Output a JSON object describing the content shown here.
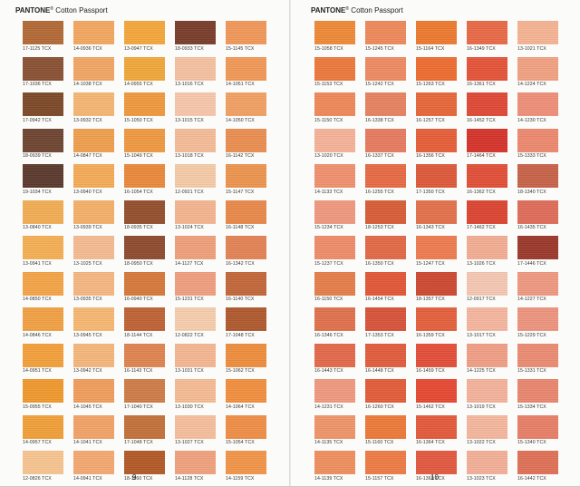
{
  "pages": [
    {
      "header_brand": "PANTONE",
      "header_reg": "®",
      "header_title": "Cotton Passport",
      "page_number": "9",
      "rows": [
        [
          {
            "code": "17-1125 TCX",
            "color": "#b46a38"
          },
          {
            "code": "14-0936 TCX",
            "color": "#f4a862"
          },
          {
            "code": "13-0947 TCX",
            "color": "#f5a83c"
          },
          {
            "code": "18-0933 TCX",
            "color": "#7a3d2c"
          },
          {
            "code": "15-1145 TCX",
            "color": "#f2995a"
          }
        ],
        [
          {
            "code": "17-1036 TCX",
            "color": "#8a5234"
          },
          {
            "code": "14-1038 TCX",
            "color": "#f3a766"
          },
          {
            "code": "14-0955 TCX",
            "color": "#f2a93d"
          },
          {
            "code": "13-1016 TCX",
            "color": "#f6c2a2"
          },
          {
            "code": "14-1051 TCX",
            "color": "#f29a58"
          }
        ],
        [
          {
            "code": "17-0942 TCX",
            "color": "#7d4a2a"
          },
          {
            "code": "13-0932 TCX",
            "color": "#f7b874"
          },
          {
            "code": "15-1050 TCX",
            "color": "#f19a3f"
          },
          {
            "code": "13-1015 TCX",
            "color": "#f8c8ad"
          },
          {
            "code": "14-1050 TCX",
            "color": "#f2a264"
          }
        ],
        [
          {
            "code": "18-0939 TCX",
            "color": "#6f4532"
          },
          {
            "code": "14-0847 TCX",
            "color": "#f0a050"
          },
          {
            "code": "15-1049 TCX",
            "color": "#f09a42"
          },
          {
            "code": "13-1018 TCX",
            "color": "#f6bd9a"
          },
          {
            "code": "16-1142 TCX",
            "color": "#ec8f52"
          }
        ],
        [
          {
            "code": "19-1034 TCX",
            "color": "#5c3a2e"
          },
          {
            "code": "13-0940 TCX",
            "color": "#f6ac58"
          },
          {
            "code": "16-1054 TCX",
            "color": "#eb8a3c"
          },
          {
            "code": "12-0921 TCX",
            "color": "#f7cca9"
          },
          {
            "code": "15-1147 TCX",
            "color": "#ee9550"
          }
        ],
        [
          {
            "code": "13-0840 TCX",
            "color": "#f3ae55"
          },
          {
            "code": "13-0939 TCX",
            "color": "#f6b26a"
          },
          {
            "code": "18-0935 TCX",
            "color": "#95502e"
          },
          {
            "code": "13-1024 TCX",
            "color": "#f5b790"
          },
          {
            "code": "16-1148 TCX",
            "color": "#ea8a4c"
          }
        ],
        [
          {
            "code": "13-0941 TCX",
            "color": "#f6b056"
          },
          {
            "code": "13-1025 TCX",
            "color": "#f6bc92"
          },
          {
            "code": "18-0950 TCX",
            "color": "#8e4c30"
          },
          {
            "code": "14-1127 TCX",
            "color": "#f0a07c"
          },
          {
            "code": "16-1342 TCX",
            "color": "#e58456"
          }
        ],
        [
          {
            "code": "14-0850 TCX",
            "color": "#f5a548"
          },
          {
            "code": "13-0935 TCX",
            "color": "#f7b882"
          },
          {
            "code": "16-0940 TCX",
            "color": "#d77a3c"
          },
          {
            "code": "15-1231 TCX",
            "color": "#f1a080"
          },
          {
            "code": "16-1140 TCX",
            "color": "#c4683c"
          }
        ],
        [
          {
            "code": "14-0846 TCX",
            "color": "#f2a245"
          },
          {
            "code": "13-0945 TCX",
            "color": "#f8b973"
          },
          {
            "code": "18-1144 TCX",
            "color": "#c06436"
          },
          {
            "code": "12-0822 TCX",
            "color": "#f7cfae"
          },
          {
            "code": "17-1048 TCX",
            "color": "#b15a30"
          }
        ],
        [
          {
            "code": "14-0951 TCX",
            "color": "#f4a13c"
          },
          {
            "code": "13-0942 TCX",
            "color": "#f7b87c"
          },
          {
            "code": "16-1143 TCX",
            "color": "#e08552"
          },
          {
            "code": "13-1031 TCX",
            "color": "#f6b894"
          },
          {
            "code": "15-1062 TCX",
            "color": "#ef8e3e"
          }
        ],
        [
          {
            "code": "15-0955 TCX",
            "color": "#f19a2f"
          },
          {
            "code": "14-1045 TCX",
            "color": "#f29e5e"
          },
          {
            "code": "17-1040 TCX",
            "color": "#d07d48"
          },
          {
            "code": "13-1030 TCX",
            "color": "#f7bd95"
          },
          {
            "code": "14-1064 TCX",
            "color": "#f39040"
          }
        ],
        [
          {
            "code": "14-0957 TCX",
            "color": "#f2a03a"
          },
          {
            "code": "14-1041 TCX",
            "color": "#f2a468"
          },
          {
            "code": "17-1048 TCX",
            "color": "#c4723c"
          },
          {
            "code": "13-1027 TCX",
            "color": "#f7c09d"
          },
          {
            "code": "15-1054 TCX",
            "color": "#f08f48"
          }
        ],
        [
          {
            "code": "12-0826 TCX",
            "color": "#f8c690"
          },
          {
            "code": "14-0941 TCX",
            "color": "#f5aa72"
          },
          {
            "code": "18-1160 TCX",
            "color": "#b45a28"
          },
          {
            "code": "14-1128 TCX",
            "color": "#f1a27e"
          },
          {
            "code": "14-1159 TCX",
            "color": "#f3964a"
          }
        ]
      ]
    },
    {
      "header_brand": "PANTONE",
      "header_reg": "®",
      "header_title": "Cotton Passport",
      "page_number": "10",
      "rows": [
        [
          {
            "code": "15-1058 TCX",
            "color": "#ef8a38"
          },
          {
            "code": "15-1245 TCX",
            "color": "#ef8a5c"
          },
          {
            "code": "15-1164 TCX",
            "color": "#ee7a30"
          },
          {
            "code": "16-1349 TCX",
            "color": "#ea6a48"
          },
          {
            "code": "13-1021 TCX",
            "color": "#f6b594"
          }
        ],
        [
          {
            "code": "15-1153 TCX",
            "color": "#ee7a3e"
          },
          {
            "code": "15-1242 TCX",
            "color": "#ef8c64"
          },
          {
            "code": "15-1263 TCX",
            "color": "#ee6e32"
          },
          {
            "code": "16-1361 TCX",
            "color": "#e6553a"
          },
          {
            "code": "14-1224 TCX",
            "color": "#f3a384"
          }
        ],
        [
          {
            "code": "15-1150 TCX",
            "color": "#ef8a5a"
          },
          {
            "code": "16-1338 TCX",
            "color": "#e88462"
          },
          {
            "code": "16-1257 TCX",
            "color": "#e8683a"
          },
          {
            "code": "16-1452 TCX",
            "color": "#e04a36"
          },
          {
            "code": "14-1230 TCX",
            "color": "#f0907a"
          }
        ],
        [
          {
            "code": "13-1020 TCX",
            "color": "#f6b499"
          },
          {
            "code": "16-1337 TCX",
            "color": "#e87c62"
          },
          {
            "code": "16-1356 TCX",
            "color": "#e8603a"
          },
          {
            "code": "17-1464 TCX",
            "color": "#d7352c"
          },
          {
            "code": "15-1333 TCX",
            "color": "#ee8a70"
          }
        ],
        [
          {
            "code": "14-1133 TCX",
            "color": "#f19270"
          },
          {
            "code": "16-1255 TCX",
            "color": "#e86c44"
          },
          {
            "code": "17-1350 TCX",
            "color": "#df5a3c"
          },
          {
            "code": "16-1362 TCX",
            "color": "#e25038"
          },
          {
            "code": "18-1340 TCX",
            "color": "#c8644a"
          }
        ],
        [
          {
            "code": "15-1234 TCX",
            "color": "#f09a80"
          },
          {
            "code": "18-1253 TCX",
            "color": "#d95e38"
          },
          {
            "code": "16-1343 TCX",
            "color": "#e4724c"
          },
          {
            "code": "17-1462 TCX",
            "color": "#dd4632"
          },
          {
            "code": "16-1435 TCX",
            "color": "#e06e5a"
          }
        ],
        [
          {
            "code": "15-1237 TCX",
            "color": "#ef8d6a"
          },
          {
            "code": "16-1350 TCX",
            "color": "#e36a48"
          },
          {
            "code": "15-1247 TCX",
            "color": "#ef7c50"
          },
          {
            "code": "13-1026 TCX",
            "color": "#f3ae94"
          },
          {
            "code": "17-1446 TCX",
            "color": "#9c3a2c"
          }
        ],
        [
          {
            "code": "16-1150 TCX",
            "color": "#e7804c"
          },
          {
            "code": "16-1454 TCX",
            "color": "#e45838"
          },
          {
            "code": "18-1357 TCX",
            "color": "#cf4a32"
          },
          {
            "code": "12-0917 TCX",
            "color": "#f6c9b4"
          },
          {
            "code": "14-1227 TCX",
            "color": "#f09a82"
          }
        ],
        [
          {
            "code": "16-1346 TCX",
            "color": "#e2734e"
          },
          {
            "code": "17-1353 TCX",
            "color": "#d9543a"
          },
          {
            "code": "16-1359 TCX",
            "color": "#e6623e"
          },
          {
            "code": "13-1017 TCX",
            "color": "#f6b7a0"
          },
          {
            "code": "15-1229 TCX",
            "color": "#ee9680"
          }
        ],
        [
          {
            "code": "16-1443 TCX",
            "color": "#e46a4c"
          },
          {
            "code": "16-1448 TCX",
            "color": "#e25e3e"
          },
          {
            "code": "16-1459 TCX",
            "color": "#e4503a"
          },
          {
            "code": "14-1225 TCX",
            "color": "#f1a086"
          },
          {
            "code": "15-1331 TCX",
            "color": "#ec8c74"
          }
        ],
        [
          {
            "code": "14-1231 TCX",
            "color": "#f19a80"
          },
          {
            "code": "16-1260 TCX",
            "color": "#e45e3a"
          },
          {
            "code": "15-1462 TCX",
            "color": "#e84a34"
          },
          {
            "code": "13-1019 TCX",
            "color": "#f5b49c"
          },
          {
            "code": "15-1334 TCX",
            "color": "#eb8870"
          }
        ],
        [
          {
            "code": "14-1135 TCX",
            "color": "#f0966a"
          },
          {
            "code": "15-1160 TCX",
            "color": "#ee7a3a"
          },
          {
            "code": "16-1364 TCX",
            "color": "#e55a3c"
          },
          {
            "code": "13-1022 TCX",
            "color": "#f5b89e"
          },
          {
            "code": "15-1340 TCX",
            "color": "#e98068"
          }
        ],
        [
          {
            "code": "14-1139 TCX",
            "color": "#f09060"
          },
          {
            "code": "15-1157 TCX",
            "color": "#ef7c46"
          },
          {
            "code": "16-1360 TCX",
            "color": "#e35a40"
          },
          {
            "code": "13-1023 TCX",
            "color": "#f4b098"
          },
          {
            "code": "16-1442 TCX",
            "color": "#e07258"
          }
        ]
      ]
    }
  ]
}
